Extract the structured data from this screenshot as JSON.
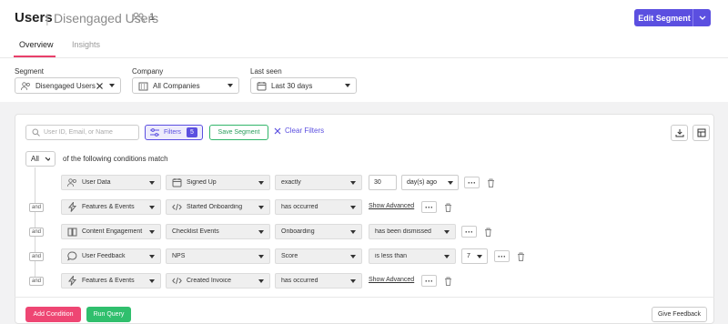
{
  "header": {
    "title": "Users",
    "separator": "|",
    "segment_name": "Disengaged Users",
    "segment_count": "1",
    "edit_button": "Edit Segment"
  },
  "tabs": [
    {
      "label": "Overview",
      "active": true
    },
    {
      "label": "Insights",
      "active": false
    }
  ],
  "filters": {
    "segment": {
      "label": "Segment",
      "value": "Disengaged Users"
    },
    "company": {
      "label": "Company",
      "value": "All Companies"
    },
    "last_seen": {
      "label": "Last seen",
      "value": "Last 30 days"
    }
  },
  "toolbar": {
    "search_placeholder": "User ID, Email, or Name",
    "filters_label": "Filters",
    "filters_count": "5",
    "save_segment": "Save Segment",
    "clear_filters": "Clear Filters"
  },
  "match": {
    "mode": "All",
    "text": "of the following conditions match"
  },
  "conditions": [
    {
      "connector": "",
      "source": "User Data",
      "event": "Signed Up",
      "operator": "exactly",
      "value": "30",
      "unit": "day(s) ago",
      "advanced": ""
    },
    {
      "connector": "and",
      "source": "Features & Events",
      "event": "Started Onboarding",
      "operator": "has occurred",
      "value": "",
      "unit": "",
      "advanced": "Show Advanced"
    },
    {
      "connector": "and",
      "source": "Content Engagement",
      "event": "Checklist Events",
      "operator": "Onboarding",
      "value": "has been dismissed",
      "unit": "",
      "advanced": ""
    },
    {
      "connector": "and",
      "source": "User Feedback",
      "event": "NPS",
      "operator": "Score",
      "value": "is less than",
      "unit": "7",
      "advanced": ""
    },
    {
      "connector": "and",
      "source": "Features & Events",
      "event": "Created Invoice",
      "operator": "has occurred",
      "value": "",
      "unit": "",
      "advanced": "Show Advanced"
    }
  ],
  "footer": {
    "add_condition": "Add Condition",
    "run_query": "Run Query",
    "give_feedback": "Give Feedback"
  },
  "colors": {
    "primary": "#5b4fe0",
    "accent": "#e83f6a",
    "success": "#30bf6d"
  }
}
